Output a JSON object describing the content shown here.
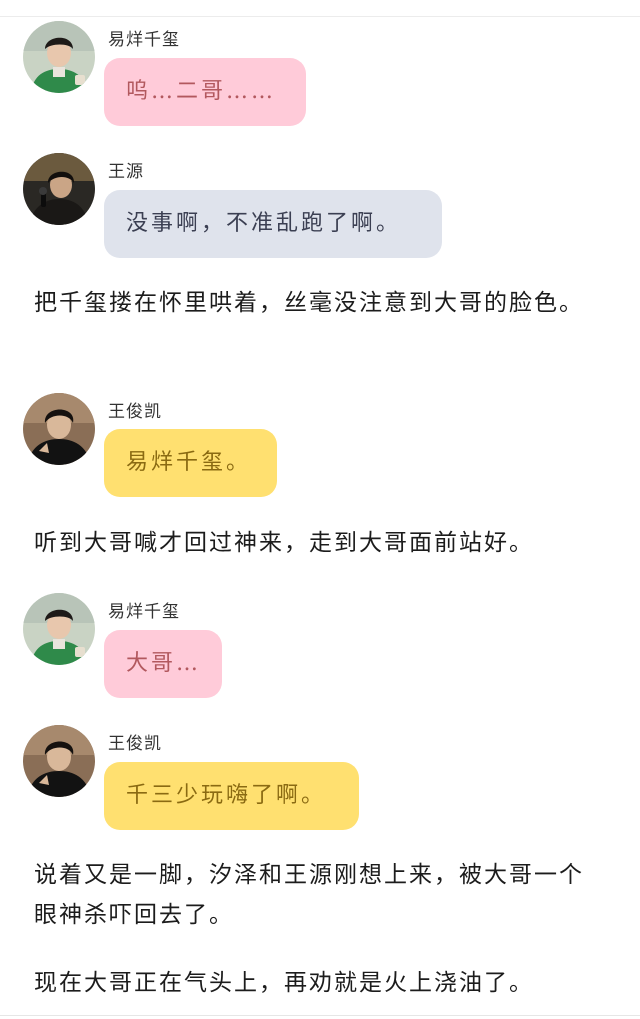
{
  "colors": {
    "bubble_pink": "#ffcbd9",
    "bubble_blue": "#dfe3ec",
    "bubble_yellow": "#ffe070"
  },
  "messages": [
    {
      "sender": "易烊千玺",
      "text": "呜…二哥……",
      "bubble_color": "pink",
      "avatar": "avatar-green-jersey"
    },
    {
      "sender": "王源",
      "text": "没事啊，不准乱跑了啊。",
      "bubble_color": "blue",
      "avatar": "avatar-mic-singer"
    },
    {
      "sender": "王俊凯",
      "text": "易烊千玺。",
      "bubble_color": "yellow",
      "avatar": "avatar-black-jacket"
    },
    {
      "sender": "易烊千玺",
      "text": "大哥…",
      "bubble_color": "pink",
      "avatar": "avatar-green-jersey"
    },
    {
      "sender": "王俊凯",
      "text": "千三少玩嗨了啊。",
      "bubble_color": "yellow",
      "avatar": "avatar-black-jacket"
    }
  ],
  "narrations": [
    "把千玺搂在怀里哄着，丝毫没注意到大哥的脸色。",
    "听到大哥喊才回过神来，走到大哥面前站好。",
    "说着又是一脚，汐泽和王源刚想上来，被大哥一个眼神杀吓回去了。",
    "现在大哥正在气头上，再劝就是火上浇油了。"
  ]
}
